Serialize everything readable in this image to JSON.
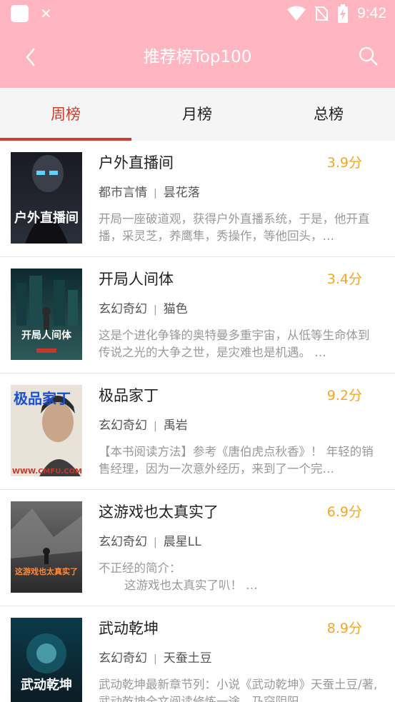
{
  "status_bar": {
    "time": "9:42",
    "icons": [
      "app-icon",
      "close-icon",
      "wifi-icon",
      "no-sim-icon",
      "battery-charging-icon"
    ]
  },
  "app_bar": {
    "title": "推荐榜Top100",
    "back_icon": "back-arrow-icon",
    "search_icon": "search-icon"
  },
  "tabs": [
    {
      "label": "周榜",
      "active": true
    },
    {
      "label": "月榜",
      "active": false
    },
    {
      "label": "总榜",
      "active": false
    }
  ],
  "colors": {
    "primary": "#ffb6c1",
    "tab_active": "#c93f2d",
    "score": "#f5a623"
  },
  "books": [
    {
      "title": "户外直播间",
      "score": "3.9分",
      "category": "都市言情",
      "author": "昙花落",
      "desc": "开局一座破道观，获得户外直播系统，于是，他开直播，采灵芝，养鹰隼，秀操作，等他回头，…",
      "cover_text": "户外直播间"
    },
    {
      "title": "开局人间体",
      "score": "3.4分",
      "category": "玄幻奇幻",
      "author": "猫色",
      "desc": "这是个进化争锋的奥特曼多重宇宙，从低等生命体到传说之光的大争之世，是灾难也是机遇。 …",
      "cover_text": "开局人间体"
    },
    {
      "title": "极品家丁",
      "score": "9.2分",
      "category": "玄幻奇幻",
      "author": "禹岩",
      "desc": "【本书阅读方法】参考《唐伯虎点秋香》！ 年轻的销售经理，因为一次意外经历，来到了一个完…",
      "cover_text": "极品家丁"
    },
    {
      "title": "这游戏也太真实了",
      "score": "6.9分",
      "category": "玄幻奇幻",
      "author": "晨星LL",
      "desc_line1": "不正经的简介：",
      "desc_line2": "这游戏也太真实了叭！ …",
      "cover_text": "这游戏也太真实了"
    },
    {
      "title": "武动乾坤",
      "score": "8.9分",
      "category": "玄幻奇幻",
      "author": "天蚕土豆",
      "desc": "武动乾坤最新章节列：小说《武动乾坤》天蚕土豆/著,武动乾坤全文阅读修炼一途，乃窃阴阳…",
      "cover_text": "武动乾坤"
    }
  ]
}
